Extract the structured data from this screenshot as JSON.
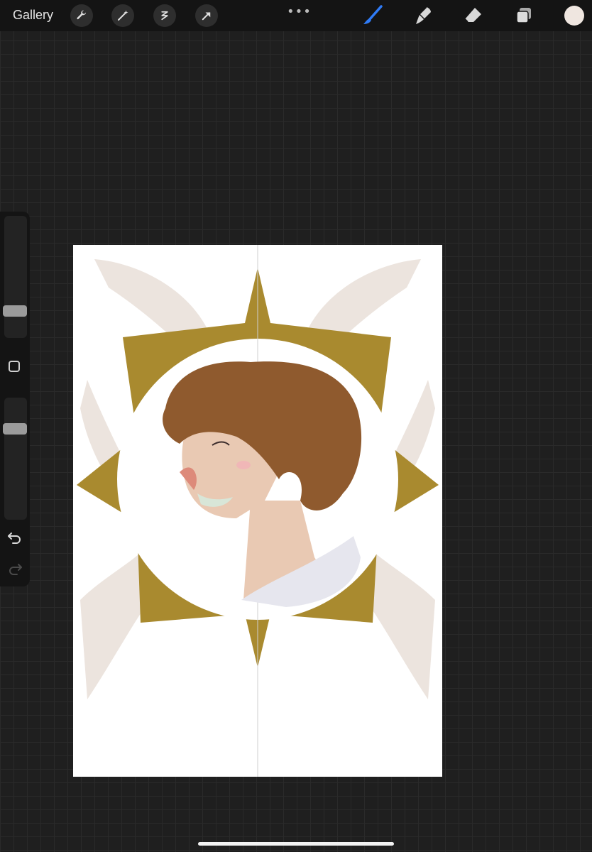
{
  "toolbar": {
    "gallery_label": "Gallery",
    "more_label": "•••",
    "left_tools": [
      "wrench-icon",
      "magic-wand-icon",
      "selection-icon",
      "transform-arrow-icon"
    ],
    "right_tools": [
      "brush-icon",
      "smudge-icon",
      "eraser-icon",
      "layers-icon"
    ],
    "active_tool": "brush-icon",
    "active_color": "#efe6e0",
    "accent_color": "#2f7bf6"
  },
  "sidebar": {
    "tools": [
      "brush-size-slider",
      "modify-button",
      "opacity-slider",
      "undo-icon",
      "redo-icon"
    ]
  },
  "artwork": {
    "description_colors": {
      "frame": "#a98a2f",
      "wings": "#ece4de",
      "hair": "#8f5a2e",
      "skin": "#e9c9b3"
    }
  }
}
